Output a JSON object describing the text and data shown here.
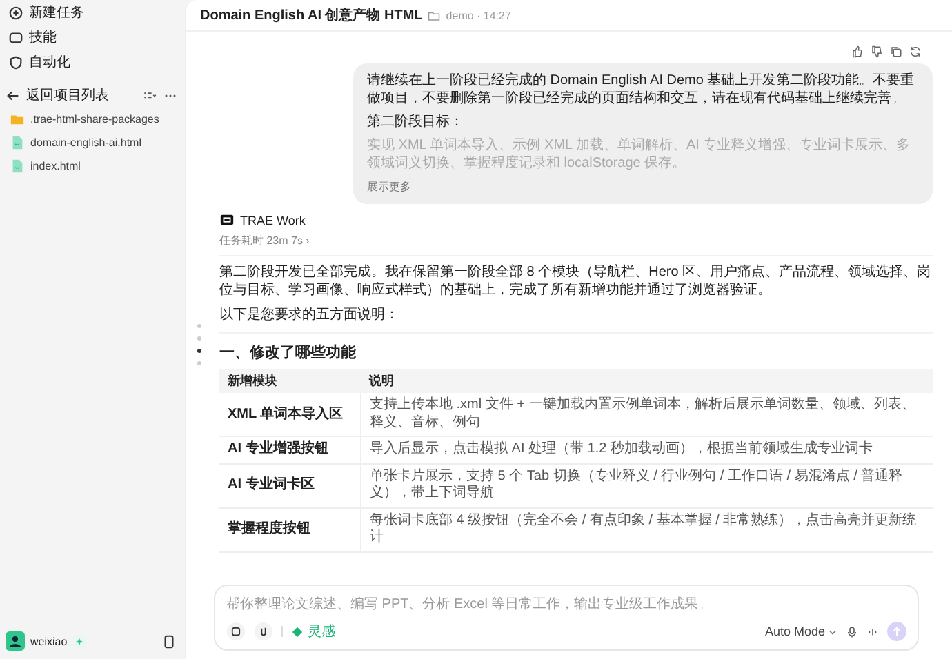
{
  "sidebar": {
    "nav_items": [
      {
        "kind": "new",
        "label": "新建任务"
      },
      {
        "kind": "skill",
        "label": "技能"
      },
      {
        "kind": "auto",
        "label": "自动化"
      }
    ],
    "back_label": "返回项目列表",
    "files": [
      {
        "kind": "folder",
        "name": ".trae-html-share-packages"
      },
      {
        "kind": "html",
        "name": "domain-english-ai.html"
      },
      {
        "kind": "html",
        "name": "index.html"
      }
    ],
    "user": {
      "name": "weixiao"
    }
  },
  "header": {
    "title": "Domain English AI 创意产物 HTML",
    "meta": "demo · 14:27"
  },
  "user_message": {
    "paragraphs": [
      "请继续在上一阶段已经完成的 Domain English AI Demo 基础上开发第二阶段功能。不要重做项目，不要删除第一阶段已经完成的页面结构和交互，请在现有代码基础上继续完善。",
      "第二阶段目标：",
      "实现 XML 单词本导入、示例 XML 加载、单词解析、AI 专业释义增强、专业词卡展示、多领域词义切换、掌握程度记录和 localStorage 保存。"
    ],
    "show_more": "展示更多"
  },
  "assistant": {
    "name": "TRAE Work",
    "duration": "任务耗时 23m 7s ›",
    "paragraphs": [
      "第二阶段开发已全部完成。我在保留第一阶段全部 8 个模块（导航栏、Hero 区、用户痛点、产品流程、领域选择、岗位与目标、学习画像、响应式样式）的基础上，完成了所有新增功能并通过了浏览器验证。",
      "以下是您要求的五方面说明："
    ],
    "heading": "一、修改了哪些功能",
    "table": {
      "columns": [
        "新增模块",
        "说明"
      ],
      "rows": [
        [
          "XML 单词本导入区",
          "支持上传本地 .xml 文件 + 一键加载内置示例单词本，解析后展示单词数量、领域、列表、释义、音标、例句"
        ],
        [
          "AI 专业增强按钮",
          "导入后显示，点击模拟 AI 处理（带 1.2 秒加载动画），根据当前领域生成专业词卡"
        ],
        [
          "AI 专业词卡区",
          "单张卡片展示，支持 5 个 Tab 切换（专业释义 / 行业例句 / 工作口语 / 易混淆点 / 普通释义），带上下词导航"
        ],
        [
          "掌握程度按钮",
          "每张词卡底部 4 级按钮（完全不会 / 有点印象 / 基本掌握 / 非常熟练），点击高亮并更新统计"
        ]
      ]
    }
  },
  "nav_dots": [
    {
      "selected": false
    },
    {
      "selected": false
    },
    {
      "selected": true
    },
    {
      "selected": false
    }
  ],
  "composer": {
    "placeholder": "帮你整理论文综述、编写 PPT、分析 Excel 等日常工作，输出专业级工作成果。",
    "skill": "灵感",
    "mode": "Auto Mode"
  }
}
